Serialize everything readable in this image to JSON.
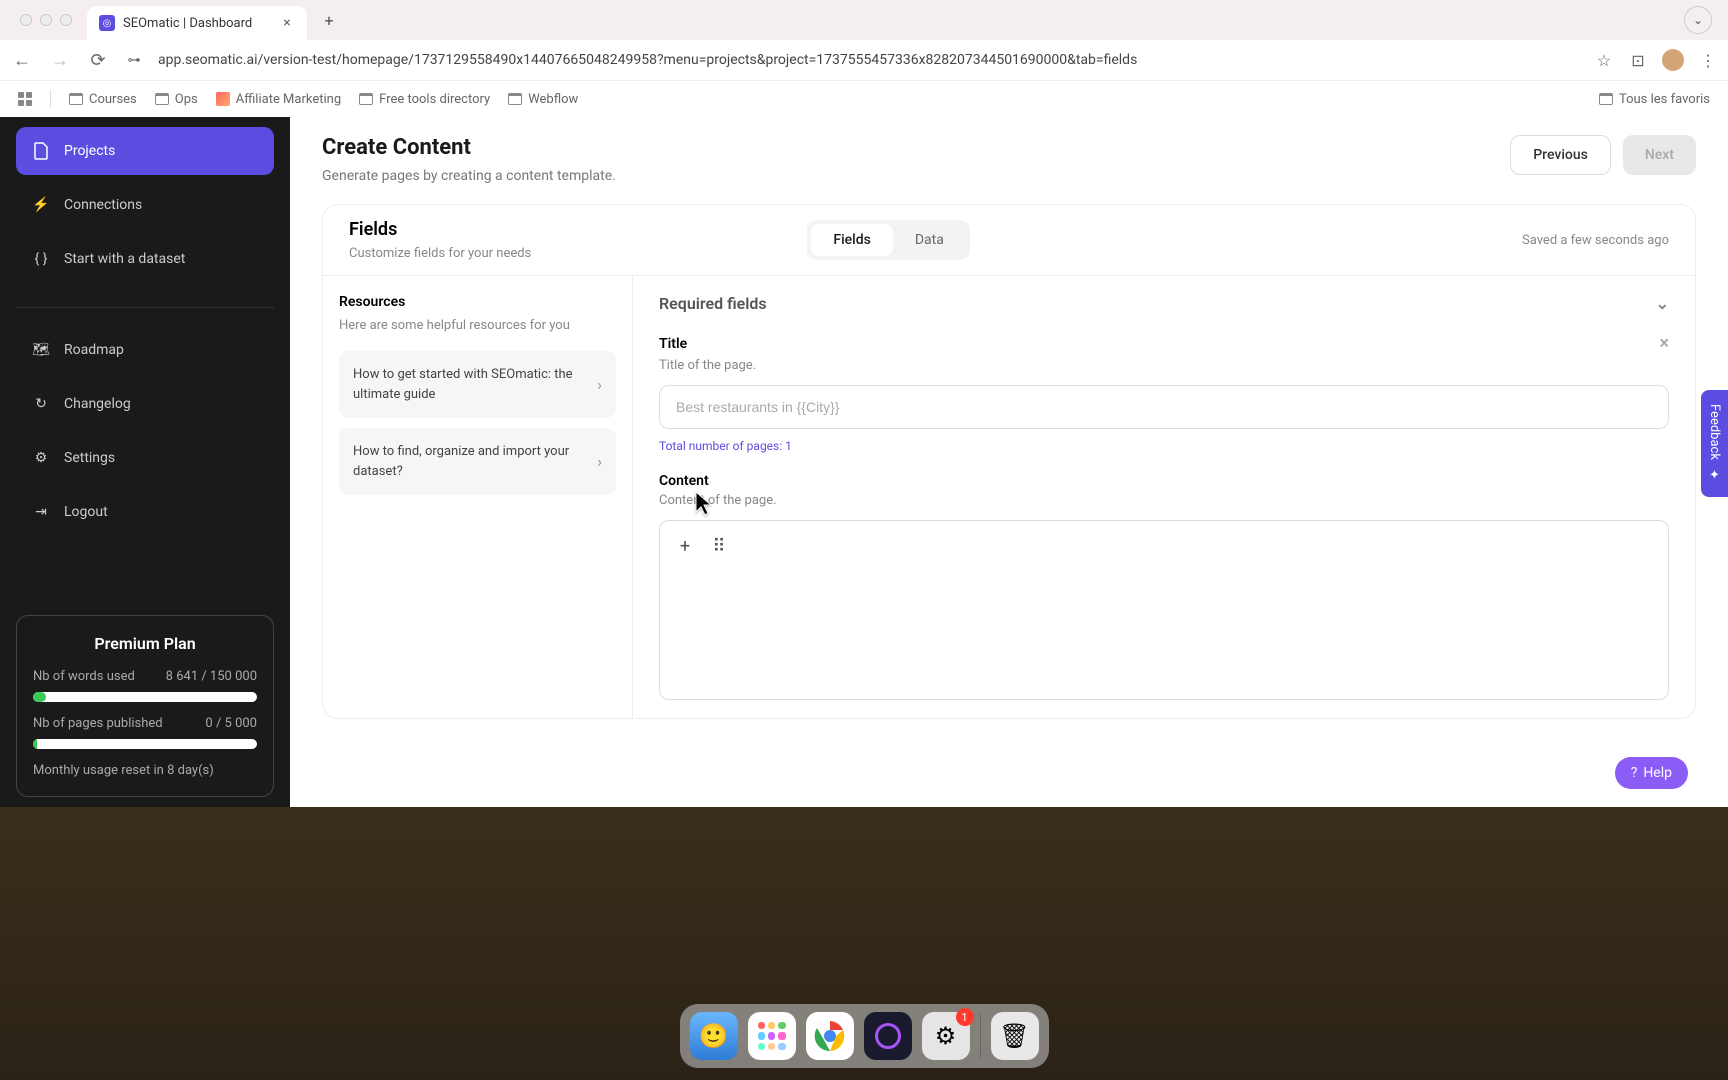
{
  "browser": {
    "tab_title": "SEOmatic | Dashboard",
    "url": "app.seomatic.ai/version-test/homepage/1737129558490x14407665048249958?menu=projects&project=1737555457336x828207344501690000&tab=fields",
    "bookmarks": [
      "Courses",
      "Ops",
      "Affiliate Marketing",
      "Free tools directory",
      "Webflow"
    ],
    "all_bookmarks": "Tous les favoris"
  },
  "sidebar": {
    "items": [
      {
        "label": "Projects"
      },
      {
        "label": "Connections"
      },
      {
        "label": "Start with a dataset"
      },
      {
        "label": "Roadmap"
      },
      {
        "label": "Changelog"
      },
      {
        "label": "Settings"
      },
      {
        "label": "Logout"
      }
    ]
  },
  "plan": {
    "title": "Premium Plan",
    "words_label": "Nb of words used",
    "words_value": "8 641 / 150 000",
    "words_pct": 6,
    "pages_label": "Nb of pages published",
    "pages_value": "0 / 5 000",
    "pages_pct": 2,
    "reset": "Monthly usage reset in 8 day(s)"
  },
  "header": {
    "title": "Create Content",
    "subtitle": "Generate pages by creating a content template.",
    "prev": "Previous",
    "next": "Next"
  },
  "fieldsCard": {
    "title": "Fields",
    "subtitle": "Customize fields for your needs",
    "tabs": {
      "fields": "Fields",
      "data": "Data"
    },
    "saved": "Saved a few seconds ago"
  },
  "resources": {
    "title": "Resources",
    "subtitle": "Here are some helpful resources for you",
    "items": [
      "How to get started with SEOmatic: the ultimate guide",
      "How to find, organize and import your dataset?"
    ]
  },
  "form": {
    "section": "Required fields",
    "title_label": "Title",
    "title_desc": "Title of the page.",
    "title_placeholder": "Best restaurants in {{City}}",
    "hint": "Total number of pages: 1",
    "content_label": "Content",
    "content_desc": "Content of the page."
  },
  "feedback": "Feedback",
  "help": "Help",
  "dock": {
    "badge": "1"
  }
}
